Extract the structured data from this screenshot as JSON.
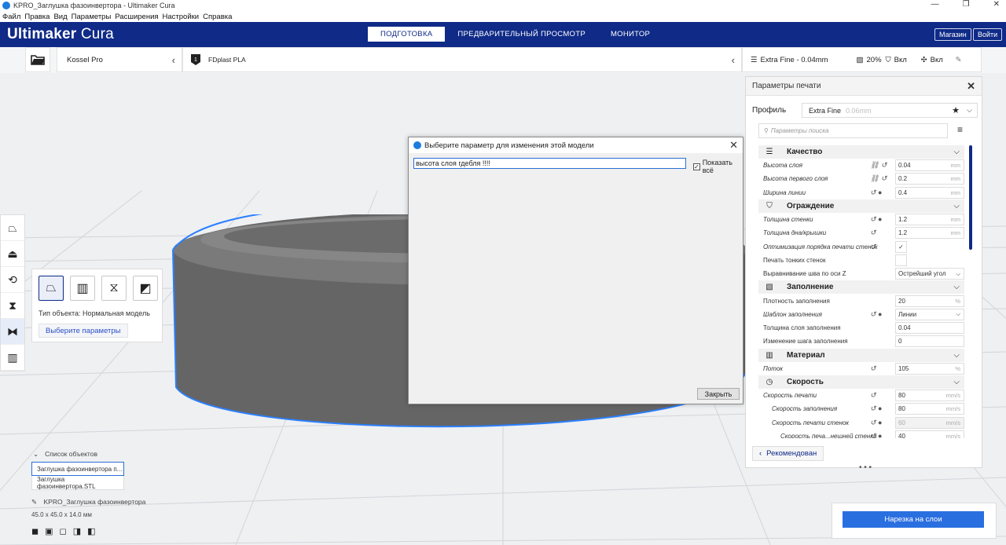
{
  "window": {
    "title": "KPRO_Заглушка фазоинвертора - Ultimaker Cura"
  },
  "menu": [
    "Файл",
    "Правка",
    "Вид",
    "Параметры",
    "Расширения",
    "Настройки",
    "Справка"
  ],
  "header": {
    "logo_bold": "Ultimaker",
    "logo_light": " Cura",
    "stages": [
      "ПОДГОТОВКА",
      "ПРЕДВАРИТЕЛЬНЫЙ ПРОСМОТР",
      "МОНИТОР"
    ],
    "marketplace": "Магазин",
    "signin": "Войти"
  },
  "printer": {
    "name": "Kossel Pro"
  },
  "material": {
    "name": "FDplast PLA"
  },
  "print_settings_bar": {
    "profile": "Extra Fine - 0.04mm",
    "infill": "20%",
    "support": "Вкл",
    "adhesion": "Вкл"
  },
  "tool_panel": {
    "object_type": "Тип объекта: Нормальная модель",
    "select_button": "Выберите параметры"
  },
  "dialog": {
    "title": "Выберите параметр для изменения этой модели",
    "filter_value": "высота слоя гдебля !!!!",
    "show_all_label": "Показать всё",
    "show_all_checked": "✓",
    "close_button": "Закрыть"
  },
  "print_settings": {
    "header": "Параметры печати",
    "profile_label": "Профиль",
    "profile_value": "Extra Fine",
    "profile_layer": "0.06mm",
    "search_placeholder": "Параметры поиска",
    "categories": [
      {
        "name": "Качество",
        "icon": "quality-icon",
        "rows": [
          {
            "label": "Высота слоя",
            "italic": true,
            "acts": "⛓ ↺",
            "value": "0.04",
            "unit": "mm"
          },
          {
            "label": "Высота первого слоя",
            "italic": true,
            "acts": "⛓ ↺",
            "value": "0.2",
            "unit": "mm"
          },
          {
            "label": "Ширина линии",
            "italic": true,
            "acts": "↺ ●",
            "value": "0.4",
            "unit": "mm"
          }
        ]
      },
      {
        "name": "Ограждение",
        "icon": "shell-icon",
        "rows": [
          {
            "label": "Толщина стенки",
            "italic": true,
            "acts": "↺ ●",
            "value": "1.2",
            "unit": "mm"
          },
          {
            "label": "Толщина дна/крышки",
            "italic": true,
            "acts": "↺",
            "value": "1.2",
            "unit": "mm"
          },
          {
            "label": "Оптимизация порядка печати стенок",
            "italic": true,
            "acts": "↺",
            "value": "✓",
            "check": true
          },
          {
            "label": "Печать тонких стенок",
            "italic": false,
            "acts": "",
            "value": "",
            "check": true
          },
          {
            "label": "Выравнивание шва по оси Z",
            "italic": false,
            "acts": "",
            "value": "Острейший угол",
            "select": true
          }
        ]
      },
      {
        "name": "Заполнение",
        "icon": "infill-icon",
        "rows": [
          {
            "label": "Плотность заполнения",
            "italic": false,
            "acts": "",
            "value": "20",
            "unit": "%"
          },
          {
            "label": "Шаблон заполнения",
            "italic": true,
            "acts": "↺ ●",
            "value": "Линии",
            "select": true
          },
          {
            "label": "Толщина слоя заполнения",
            "italic": false,
            "acts": "",
            "value": "0.04",
            "unit": ""
          },
          {
            "label": "Изменение шага заполнения",
            "italic": false,
            "acts": "",
            "value": "0",
            "unit": ""
          }
        ]
      },
      {
        "name": "Материал",
        "icon": "material-icon",
        "rows": [
          {
            "label": "Поток",
            "italic": true,
            "acts": "↺",
            "value": "105",
            "unit": "%"
          }
        ]
      },
      {
        "name": "Скорость",
        "icon": "speed-icon",
        "rows": [
          {
            "label": "Скорость печати",
            "italic": true,
            "acts": "↺",
            "value": "80",
            "unit": "mm/s"
          },
          {
            "label": "Скорость заполнения",
            "italic": true,
            "indent": 1,
            "acts": "↺ ●",
            "value": "80",
            "unit": "mm/s"
          },
          {
            "label": "Скорость печати стенок",
            "italic": true,
            "indent": 1,
            "acts": "↺ ●",
            "value": "60",
            "unit": "mm/s",
            "disabled": true
          },
          {
            "label": "Скорость печа...нешней стенки",
            "italic": true,
            "indent": 2,
            "acts": "↺ ●",
            "value": "40",
            "unit": "mm/s"
          }
        ]
      }
    ],
    "recommended_button": "Рекомендован"
  },
  "object_list": {
    "header": "Список объектов",
    "items": [
      "Заглушка фазоинвертора п...",
      "Заглушка фазоинвертора.STL"
    ]
  },
  "job": {
    "name": "KPRO_Заглушка фазоинвертора",
    "dimensions": "45.0 x 45.0 x 14.0 мм"
  },
  "slice_button": "Нарезка на слои"
}
